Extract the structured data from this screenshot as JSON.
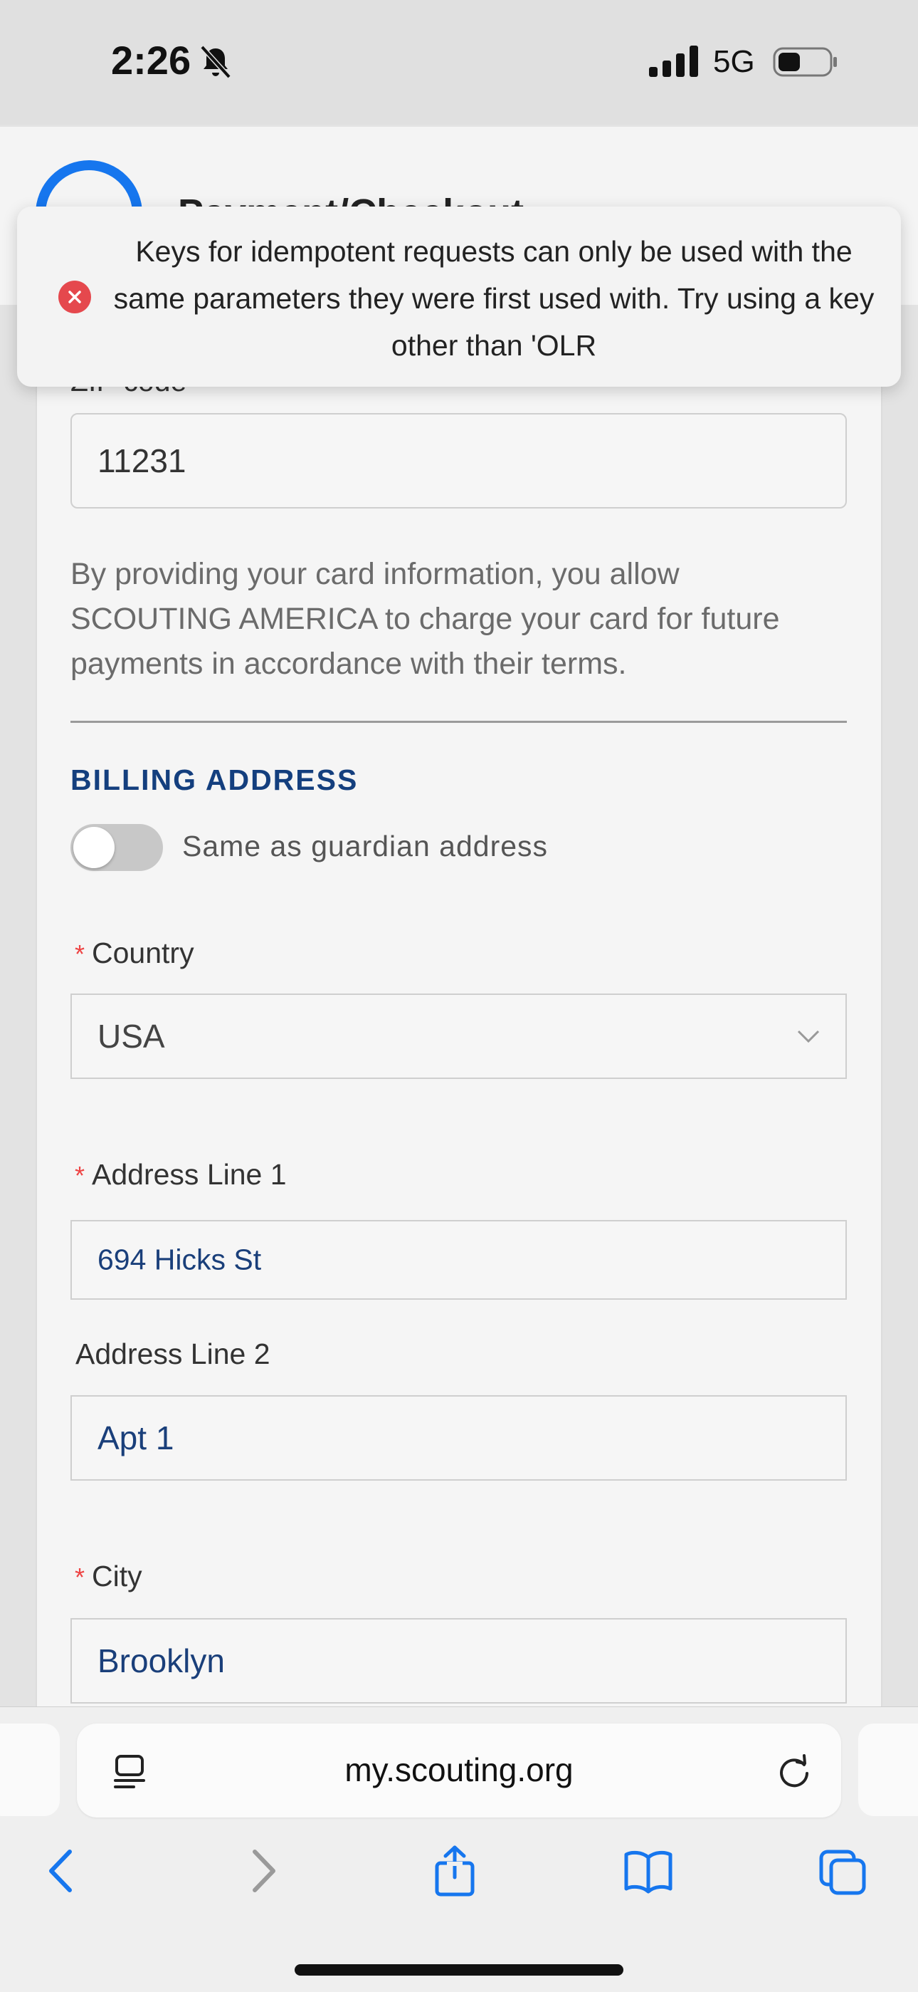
{
  "status_bar": {
    "time": "2:26",
    "network": "5G"
  },
  "header": {
    "progress": "",
    "title": "Payment/Checkout"
  },
  "toast": {
    "message": "Keys for idempotent requests can only be used with the same parameters they were first used with. Try using a key other than 'OLR"
  },
  "form": {
    "zip_label": "ZIP code",
    "zip_value": "11231",
    "consent_text": "By providing your card information, you allow SCOUTING AMERICA to charge your card for future payments in accordance with their terms.",
    "billing_heading": "BILLING ADDRESS",
    "same_as_label": "Same as guardian address",
    "same_as_on": false,
    "required_mark": "*",
    "country_label": "Country",
    "country_value": "USA",
    "address1_label": "Address Line 1",
    "address1_value": "694 Hicks St",
    "address2_label": "Address Line 2",
    "address2_value": "Apt 1",
    "city_label": "City",
    "city_value": "Brooklyn"
  },
  "browser": {
    "url": "my.scouting.org"
  },
  "colors": {
    "accent": "#1676ee",
    "heading": "#143f7e",
    "value_text": "#1a3f7a",
    "error": "#e5484d"
  },
  "icons": {
    "reader": "reader-icon",
    "reload": "reload-icon",
    "back": "chevron-left-icon",
    "forward": "chevron-right-icon",
    "share": "share-icon",
    "bookmarks": "book-icon",
    "tabs": "tabs-icon"
  }
}
